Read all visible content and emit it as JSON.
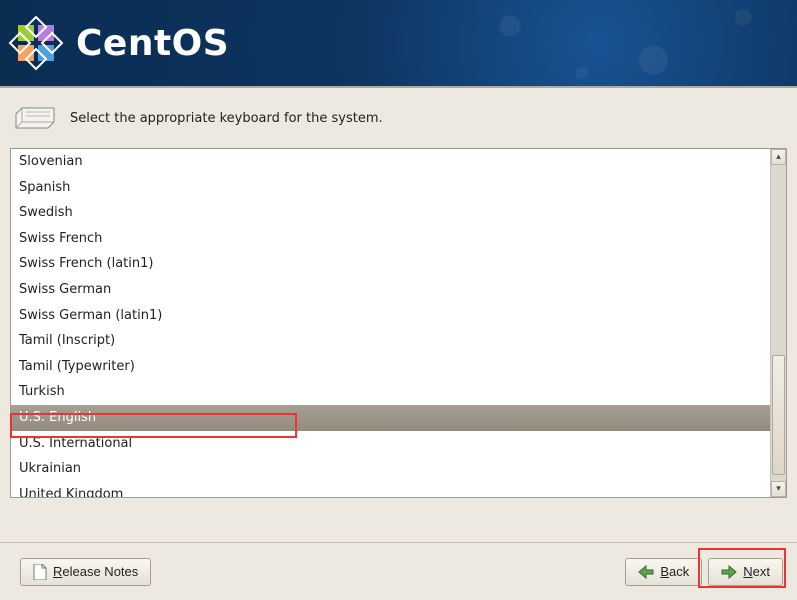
{
  "header": {
    "brand": "CentOS"
  },
  "instruction": "Select the appropriate keyboard for the system.",
  "keyboards": [
    {
      "name": "Slovenian",
      "selected": false
    },
    {
      "name": "Spanish",
      "selected": false
    },
    {
      "name": "Swedish",
      "selected": false
    },
    {
      "name": "Swiss French",
      "selected": false
    },
    {
      "name": "Swiss French (latin1)",
      "selected": false
    },
    {
      "name": "Swiss German",
      "selected": false
    },
    {
      "name": "Swiss German (latin1)",
      "selected": false
    },
    {
      "name": "Tamil (Inscript)",
      "selected": false
    },
    {
      "name": "Tamil (Typewriter)",
      "selected": false
    },
    {
      "name": "Turkish",
      "selected": false
    },
    {
      "name": "U.S. English",
      "selected": true
    },
    {
      "name": "U.S. International",
      "selected": false
    },
    {
      "name": "Ukrainian",
      "selected": false
    },
    {
      "name": "United Kingdom",
      "selected": false
    }
  ],
  "footer": {
    "release_notes": "Release Notes",
    "release_notes_key": "R",
    "back": "Back",
    "back_key": "B",
    "next": "Next",
    "next_key": "N"
  }
}
